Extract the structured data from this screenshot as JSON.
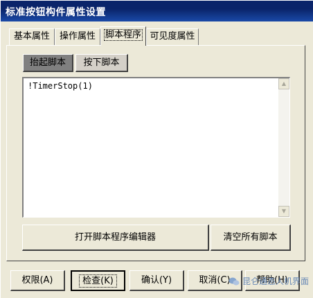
{
  "window": {
    "title": "标准按钮构件属性设置"
  },
  "tabs": [
    {
      "label": "基本属性"
    },
    {
      "label": "操作属性"
    },
    {
      "label": "脚本程序"
    },
    {
      "label": "可见度属性"
    }
  ],
  "subtabs": [
    {
      "label": "抬起脚本"
    },
    {
      "label": "按下脚本"
    }
  ],
  "editor": {
    "content": "!TimerStop(1)"
  },
  "actions": {
    "open_editor": "打开脚本程序编辑器",
    "clear_all": "清空所有脚本"
  },
  "buttons": {
    "permission": "权限(A)",
    "check": "检查(K)",
    "confirm": "确认(Y)",
    "cancel": "取消(C)",
    "help": "帮助(H)"
  },
  "watermark": {
    "text": "昆仑通态人机界面"
  },
  "colors": {
    "titlebar": "#0a246a",
    "window_bg": "#ece9d8",
    "active_subtab": "#808080"
  }
}
